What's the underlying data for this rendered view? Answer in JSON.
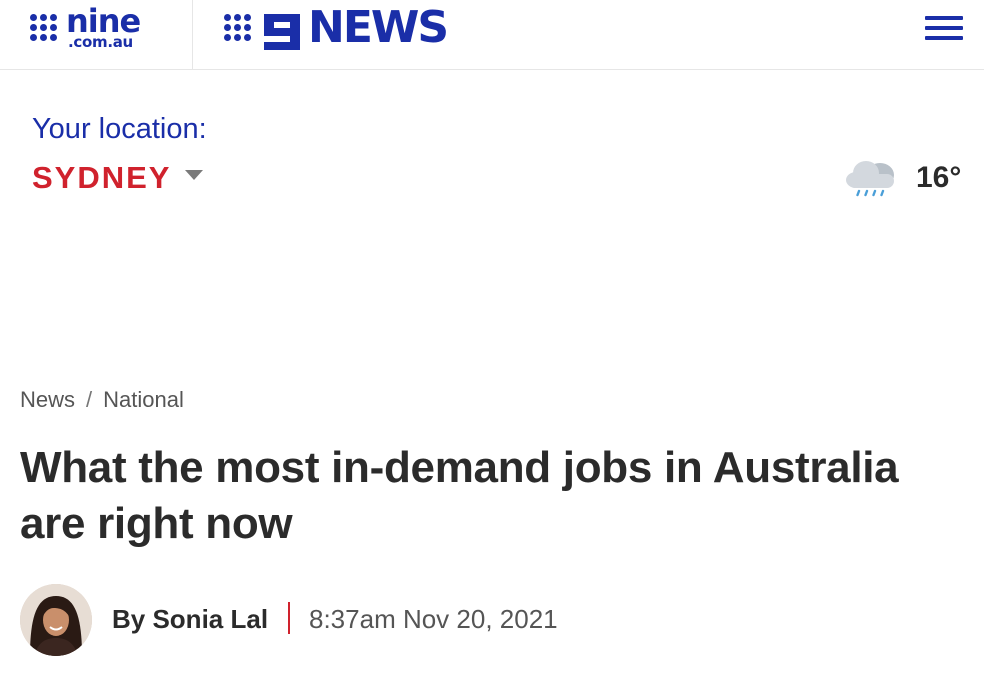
{
  "header": {
    "nine_logo": {
      "word": "nine",
      "domain": ".com.au"
    },
    "news_logo": {
      "word": "NEWS"
    },
    "menu_icon": "hamburger-menu-icon"
  },
  "location": {
    "label": "Your location:",
    "value": "SYDNEY"
  },
  "weather": {
    "icon": "rain-cloud-icon",
    "temperature": "16°"
  },
  "breadcrumb": {
    "items": [
      "News",
      "National"
    ],
    "separator": "/"
  },
  "article": {
    "title": "What the most in-demand jobs in Australia are right now",
    "author": "By Sonia Lal",
    "timestamp": "8:37am Nov 20, 2021"
  },
  "colors": {
    "brand_blue": "#1a2ea8",
    "accent_red": "#d0222d",
    "text_dark": "#2b2b2b",
    "text_muted": "#555555"
  }
}
